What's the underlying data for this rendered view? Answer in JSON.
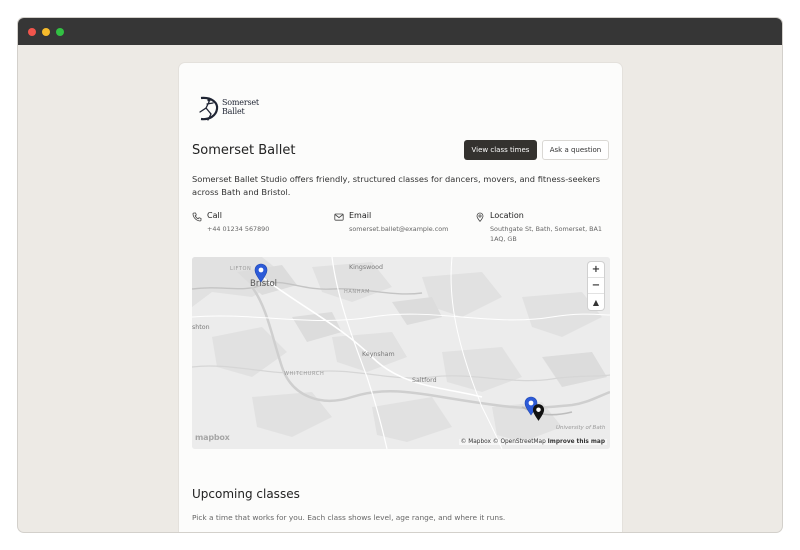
{
  "studio": {
    "logo_line1": "Somerset",
    "logo_line2": "Ballet",
    "name": "Somerset Ballet",
    "description": "Somerset Ballet Studio offers friendly, structured classes for dancers, movers, and fitness-seekers across Bath and Bristol."
  },
  "actions": {
    "primary_label": "View class times",
    "secondary_label": "Ask a question"
  },
  "contact": {
    "call_label": "Call",
    "call_value": "+44 01234 567890",
    "email_label": "Email",
    "email_value": "somerset.ballet@example.com",
    "location_label": "Location",
    "location_value": "Southgate St, Bath, Somerset, BA1 1AQ, GB"
  },
  "map": {
    "labels": {
      "clifton": "LIFTON",
      "bristol": "Bristol",
      "kingswood": "Kingswood",
      "hanham": "HANHAM",
      "ashton": "shton",
      "keynsham": "Keynsham",
      "whitchurch": "WHITCHURCH",
      "saltford": "Saltford",
      "university": "University of Bath"
    },
    "zoom_in": "+",
    "zoom_out": "−",
    "compass": "▲",
    "brand": "mapbox",
    "attribution_text": "© Mapbox © OpenStreetMap",
    "improve_link": "Improve this map",
    "pin_color": "#2d5bd8"
  },
  "classes": {
    "title": "Upcoming classes",
    "subtitle": "Pick a time that works for you. Each class shows level, age range, and where it runs."
  }
}
